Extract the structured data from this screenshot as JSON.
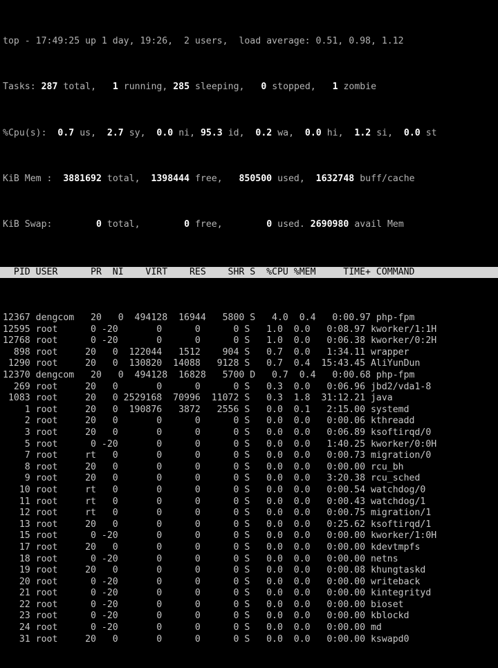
{
  "terminal": {
    "title": "top",
    "colors": {
      "background": "#000000",
      "foreground": "#c8c8c8",
      "bold_foreground": "#ffffff",
      "header_background": "#d6d6d6",
      "header_foreground": "#000000"
    }
  },
  "summary": {
    "line1": {
      "full": "top - 17:49:25 up 1 day, 19:26,  2 users,  load average: 0.51, 0.98, 1.12",
      "program": "top",
      "time": "17:49:25",
      "uptime": "up 1 day, 19:26",
      "users": "2 users",
      "load_average_label": "load average:",
      "load_average": [
        "0.51",
        "0.98",
        "1.12"
      ]
    },
    "tasks": {
      "label": "Tasks:",
      "total": "287",
      "total_label": "total,",
      "running": "1",
      "running_label": "running,",
      "sleeping": "285",
      "sleeping_label": "sleeping,",
      "stopped": "0",
      "stopped_label": "stopped,",
      "zombie": "1",
      "zombie_label": "zombie"
    },
    "cpu": {
      "label": "%Cpu(s):",
      "us": "0.7",
      "us_label": "us,",
      "sy": "2.7",
      "sy_label": "sy,",
      "ni": "0.0",
      "ni_label": "ni,",
      "id": "95.3",
      "id_label": "id,",
      "wa": "0.2",
      "wa_label": "wa,",
      "hi": "0.0",
      "hi_label": "hi,",
      "si": "1.2",
      "si_label": "si,",
      "st": "0.0",
      "st_label": "st"
    },
    "mem": {
      "label": "KiB Mem :",
      "total": "3881692",
      "total_label": "total,",
      "free": "1398444",
      "free_label": "free,",
      "used": "850500",
      "used_label": "used,",
      "buffcache": "1632748",
      "buffcache_label": "buff/cache"
    },
    "swap": {
      "label": "KiB Swap:",
      "total": "0",
      "total_label": "total,",
      "free": "0",
      "free_label": "free,",
      "used": "0",
      "used_label": "used.",
      "avail": "2690980",
      "avail_label": "avail Mem"
    }
  },
  "table": {
    "header_text": "  PID USER      PR  NI    VIRT    RES    SHR S  %CPU %MEM     TIME+ COMMAND                  ",
    "columns": [
      "PID",
      "USER",
      "PR",
      "NI",
      "VIRT",
      "RES",
      "SHR",
      "S",
      "%CPU",
      "%MEM",
      "TIME+",
      "COMMAND"
    ],
    "rows": [
      {
        "line": "12367 dengcom   20   0  494128  16944   5800 S   4.0  0.4   0:00.97 php-fpm",
        "pid": "12367",
        "user": "dengcom",
        "pr": "20",
        "ni": "0",
        "virt": "494128",
        "res": "16944",
        "shr": "5800",
        "s": "S",
        "cpu": "4.0",
        "mem": "0.4",
        "time": "0:00.97",
        "command": "php-fpm"
      },
      {
        "line": "12595 root      0 -20       0      0      0 S   1.0  0.0   0:08.97 kworker/1:1H",
        "pid": "12595",
        "user": "root",
        "pr": "0",
        "ni": "-20",
        "virt": "0",
        "res": "0",
        "shr": "0",
        "s": "S",
        "cpu": "1.0",
        "mem": "0.0",
        "time": "0:08.97",
        "command": "kworker/1:1H"
      },
      {
        "line": "12768 root      0 -20       0      0      0 S   1.0  0.0   0:06.38 kworker/0:2H",
        "pid": "12768",
        "user": "root",
        "pr": "0",
        "ni": "-20",
        "virt": "0",
        "res": "0",
        "shr": "0",
        "s": "S",
        "cpu": "1.0",
        "mem": "0.0",
        "time": "0:06.38",
        "command": "kworker/0:2H"
      },
      {
        "line": "  898 root     20   0  122044   1512    904 S   0.7  0.0   1:34.11 wrapper",
        "pid": "898",
        "user": "root",
        "pr": "20",
        "ni": "0",
        "virt": "122044",
        "res": "1512",
        "shr": "904",
        "s": "S",
        "cpu": "0.7",
        "mem": "0.0",
        "time": "1:34.11",
        "command": "wrapper"
      },
      {
        "line": " 1290 root     20   0  130820  14088   9128 S   0.7  0.4  15:43.45 AliYunDun",
        "pid": "1290",
        "user": "root",
        "pr": "20",
        "ni": "0",
        "virt": "130820",
        "res": "14088",
        "shr": "9128",
        "s": "S",
        "cpu": "0.7",
        "mem": "0.4",
        "time": "15:43.45",
        "command": "AliYunDun"
      },
      {
        "line": "12370 dengcom   20   0  494128  16828   5700 D   0.7  0.4   0:00.68 php-fpm",
        "pid": "12370",
        "user": "dengcom",
        "pr": "20",
        "ni": "0",
        "virt": "494128",
        "res": "16828",
        "shr": "5700",
        "s": "D",
        "cpu": "0.7",
        "mem": "0.4",
        "time": "0:00.68",
        "command": "php-fpm"
      },
      {
        "line": "  269 root     20   0       0      0      0 S   0.3  0.0   0:06.96 jbd2/vda1-8",
        "pid": "269",
        "user": "root",
        "pr": "20",
        "ni": "0",
        "virt": "0",
        "res": "0",
        "shr": "0",
        "s": "S",
        "cpu": "0.3",
        "mem": "0.0",
        "time": "0:06.96",
        "command": "jbd2/vda1-8"
      },
      {
        "line": " 1083 root     20   0 2529168  70996  11072 S   0.3  1.8  31:12.21 java",
        "pid": "1083",
        "user": "root",
        "pr": "20",
        "ni": "0",
        "virt": "2529168",
        "res": "70996",
        "shr": "11072",
        "s": "S",
        "cpu": "0.3",
        "mem": "1.8",
        "time": "31:12.21",
        "command": "java"
      },
      {
        "line": "    1 root     20   0  190876   3872   2556 S   0.0  0.1   2:15.00 systemd",
        "pid": "1",
        "user": "root",
        "pr": "20",
        "ni": "0",
        "virt": "190876",
        "res": "3872",
        "shr": "2556",
        "s": "S",
        "cpu": "0.0",
        "mem": "0.1",
        "time": "2:15.00",
        "command": "systemd"
      },
      {
        "line": "    2 root     20   0       0      0      0 S   0.0  0.0   0:00.06 kthreadd",
        "pid": "2",
        "user": "root",
        "pr": "20",
        "ni": "0",
        "virt": "0",
        "res": "0",
        "shr": "0",
        "s": "S",
        "cpu": "0.0",
        "mem": "0.0",
        "time": "0:00.06",
        "command": "kthreadd"
      },
      {
        "line": "    3 root     20   0       0      0      0 S   0.0  0.0   0:06.89 ksoftirqd/0",
        "pid": "3",
        "user": "root",
        "pr": "20",
        "ni": "0",
        "virt": "0",
        "res": "0",
        "shr": "0",
        "s": "S",
        "cpu": "0.0",
        "mem": "0.0",
        "time": "0:06.89",
        "command": "ksoftirqd/0"
      },
      {
        "line": "    5 root      0 -20       0      0      0 S   0.0  0.0   1:40.25 kworker/0:0H",
        "pid": "5",
        "user": "root",
        "pr": "0",
        "ni": "-20",
        "virt": "0",
        "res": "0",
        "shr": "0",
        "s": "S",
        "cpu": "0.0",
        "mem": "0.0",
        "time": "1:40.25",
        "command": "kworker/0:0H"
      },
      {
        "line": "    7 root     rt   0       0      0      0 S   0.0  0.0   0:00.73 migration/0",
        "pid": "7",
        "user": "root",
        "pr": "rt",
        "ni": "0",
        "virt": "0",
        "res": "0",
        "shr": "0",
        "s": "S",
        "cpu": "0.0",
        "mem": "0.0",
        "time": "0:00.73",
        "command": "migration/0"
      },
      {
        "line": "    8 root     20   0       0      0      0 S   0.0  0.0   0:00.00 rcu_bh",
        "pid": "8",
        "user": "root",
        "pr": "20",
        "ni": "0",
        "virt": "0",
        "res": "0",
        "shr": "0",
        "s": "S",
        "cpu": "0.0",
        "mem": "0.0",
        "time": "0:00.00",
        "command": "rcu_bh"
      },
      {
        "line": "    9 root     20   0       0      0      0 S   0.0  0.0   3:20.38 rcu_sched",
        "pid": "9",
        "user": "root",
        "pr": "20",
        "ni": "0",
        "virt": "0",
        "res": "0",
        "shr": "0",
        "s": "S",
        "cpu": "0.0",
        "mem": "0.0",
        "time": "3:20.38",
        "command": "rcu_sched"
      },
      {
        "line": "   10 root     rt   0       0      0      0 S   0.0  0.0   0:00.54 watchdog/0",
        "pid": "10",
        "user": "root",
        "pr": "rt",
        "ni": "0",
        "virt": "0",
        "res": "0",
        "shr": "0",
        "s": "S",
        "cpu": "0.0",
        "mem": "0.0",
        "time": "0:00.54",
        "command": "watchdog/0"
      },
      {
        "line": "   11 root     rt   0       0      0      0 S   0.0  0.0   0:00.43 watchdog/1",
        "pid": "11",
        "user": "root",
        "pr": "rt",
        "ni": "0",
        "virt": "0",
        "res": "0",
        "shr": "0",
        "s": "S",
        "cpu": "0.0",
        "mem": "0.0",
        "time": "0:00.43",
        "command": "watchdog/1"
      },
      {
        "line": "   12 root     rt   0       0      0      0 S   0.0  0.0   0:00.75 migration/1",
        "pid": "12",
        "user": "root",
        "pr": "rt",
        "ni": "0",
        "virt": "0",
        "res": "0",
        "shr": "0",
        "s": "S",
        "cpu": "0.0",
        "mem": "0.0",
        "time": "0:00.75",
        "command": "migration/1"
      },
      {
        "line": "   13 root     20   0       0      0      0 S   0.0  0.0   0:25.62 ksoftirqd/1",
        "pid": "13",
        "user": "root",
        "pr": "20",
        "ni": "0",
        "virt": "0",
        "res": "0",
        "shr": "0",
        "s": "S",
        "cpu": "0.0",
        "mem": "0.0",
        "time": "0:25.62",
        "command": "ksoftirqd/1"
      },
      {
        "line": "   15 root      0 -20       0      0      0 S   0.0  0.0   0:00.00 kworker/1:0H",
        "pid": "15",
        "user": "root",
        "pr": "0",
        "ni": "-20",
        "virt": "0",
        "res": "0",
        "shr": "0",
        "s": "S",
        "cpu": "0.0",
        "mem": "0.0",
        "time": "0:00.00",
        "command": "kworker/1:0H"
      },
      {
        "line": "   17 root     20   0       0      0      0 S   0.0  0.0   0:00.00 kdevtmpfs",
        "pid": "17",
        "user": "root",
        "pr": "20",
        "ni": "0",
        "virt": "0",
        "res": "0",
        "shr": "0",
        "s": "S",
        "cpu": "0.0",
        "mem": "0.0",
        "time": "0:00.00",
        "command": "kdevtmpfs"
      },
      {
        "line": "   18 root      0 -20       0      0      0 S   0.0  0.0   0:00.00 netns",
        "pid": "18",
        "user": "root",
        "pr": "0",
        "ni": "-20",
        "virt": "0",
        "res": "0",
        "shr": "0",
        "s": "S",
        "cpu": "0.0",
        "mem": "0.0",
        "time": "0:00.00",
        "command": "netns"
      },
      {
        "line": "   19 root     20   0       0      0      0 S   0.0  0.0   0:00.08 khungtaskd",
        "pid": "19",
        "user": "root",
        "pr": "20",
        "ni": "0",
        "virt": "0",
        "res": "0",
        "shr": "0",
        "s": "S",
        "cpu": "0.0",
        "mem": "0.0",
        "time": "0:00.08",
        "command": "khungtaskd"
      },
      {
        "line": "   20 root      0 -20       0      0      0 S   0.0  0.0   0:00.00 writeback",
        "pid": "20",
        "user": "root",
        "pr": "0",
        "ni": "-20",
        "virt": "0",
        "res": "0",
        "shr": "0",
        "s": "S",
        "cpu": "0.0",
        "mem": "0.0",
        "time": "0:00.00",
        "command": "writeback"
      },
      {
        "line": "   21 root      0 -20       0      0      0 S   0.0  0.0   0:00.00 kintegrityd",
        "pid": "21",
        "user": "root",
        "pr": "0",
        "ni": "-20",
        "virt": "0",
        "res": "0",
        "shr": "0",
        "s": "S",
        "cpu": "0.0",
        "mem": "0.0",
        "time": "0:00.00",
        "command": "kintegrityd"
      },
      {
        "line": "   22 root      0 -20       0      0      0 S   0.0  0.0   0:00.00 bioset",
        "pid": "22",
        "user": "root",
        "pr": "0",
        "ni": "-20",
        "virt": "0",
        "res": "0",
        "shr": "0",
        "s": "S",
        "cpu": "0.0",
        "mem": "0.0",
        "time": "0:00.00",
        "command": "bioset"
      },
      {
        "line": "   23 root      0 -20       0      0      0 S   0.0  0.0   0:00.00 kblockd",
        "pid": "23",
        "user": "root",
        "pr": "0",
        "ni": "-20",
        "virt": "0",
        "res": "0",
        "shr": "0",
        "s": "S",
        "cpu": "0.0",
        "mem": "0.0",
        "time": "0:00.00",
        "command": "kblockd"
      },
      {
        "line": "   24 root      0 -20       0      0      0 S   0.0  0.0   0:00.00 md",
        "pid": "24",
        "user": "root",
        "pr": "0",
        "ni": "-20",
        "virt": "0",
        "res": "0",
        "shr": "0",
        "s": "S",
        "cpu": "0.0",
        "mem": "0.0",
        "time": "0:00.00",
        "command": "md"
      },
      {
        "line": "   31 root     20   0       0      0      0 S   0.0  0.0   0:00.00 kswapd0",
        "pid": "31",
        "user": "root",
        "pr": "20",
        "ni": "0",
        "virt": "0",
        "res": "0",
        "shr": "0",
        "s": "S",
        "cpu": "0.0",
        "mem": "0.0",
        "time": "0:00.00",
        "command": "kswapd0"
      }
    ]
  }
}
